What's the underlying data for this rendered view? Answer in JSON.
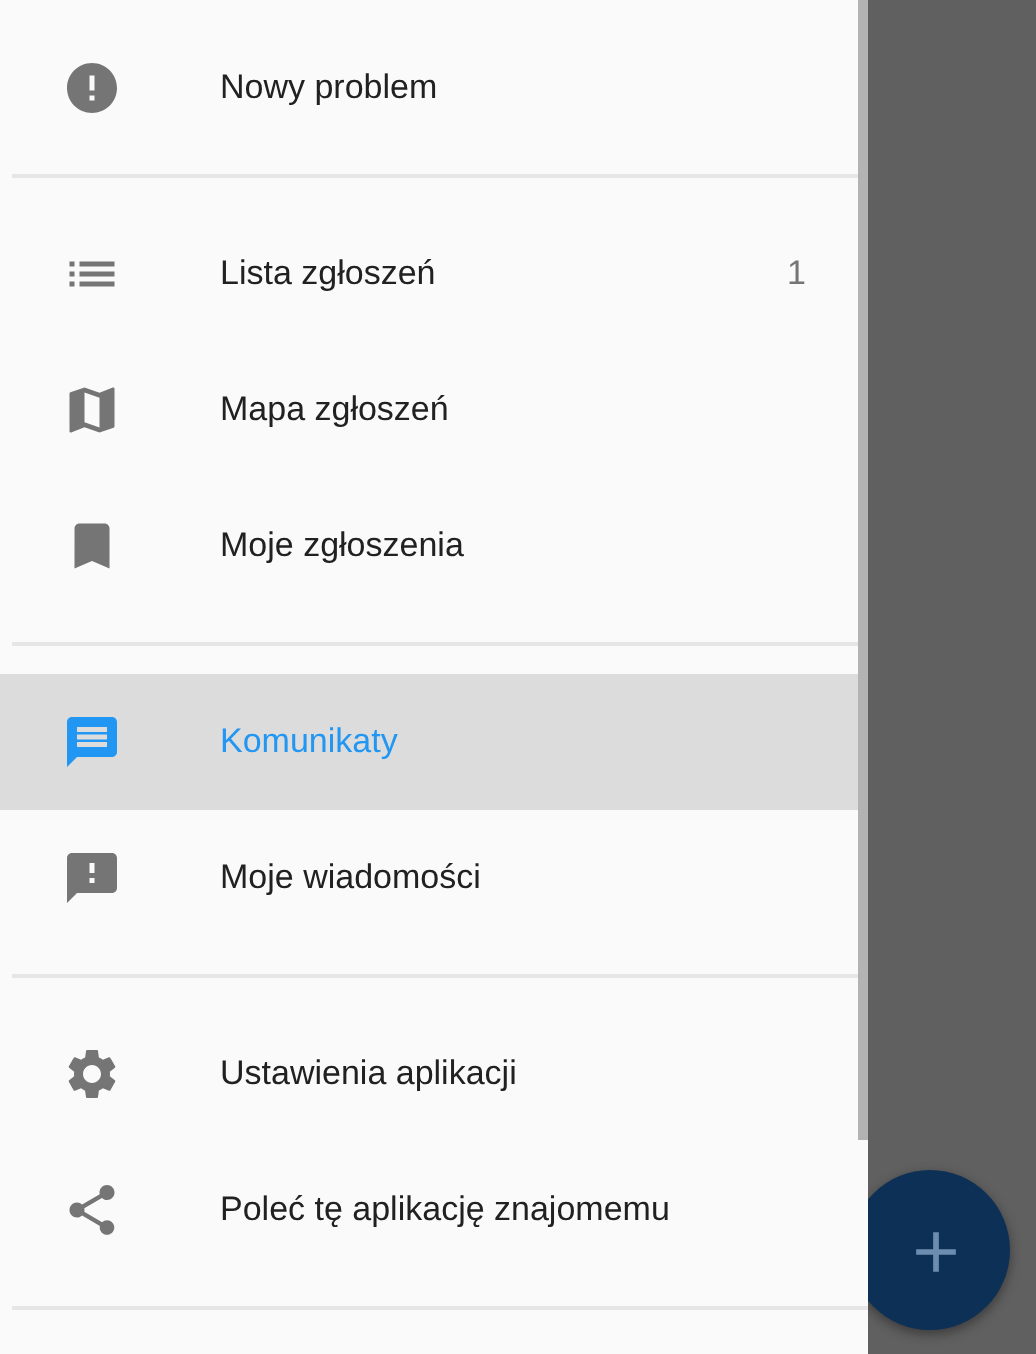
{
  "drawer": {
    "sections": [
      {
        "items": [
          {
            "kind": "alert",
            "label": "Nowy problem",
            "selected": false
          }
        ]
      },
      {
        "items": [
          {
            "kind": "list",
            "label": "Lista zgłoszeń",
            "badge": "1",
            "selected": false
          },
          {
            "kind": "map",
            "label": "Mapa zgłoszeń",
            "selected": false
          },
          {
            "kind": "bookmark",
            "label": "Moje zgłoszenia",
            "selected": false
          }
        ]
      },
      {
        "items": [
          {
            "kind": "message",
            "label": "Komunikaty",
            "selected": true
          },
          {
            "kind": "feedback",
            "label": "Moje wiadomości",
            "selected": false
          }
        ]
      },
      {
        "items": [
          {
            "kind": "settings",
            "label": "Ustawienia aplikacji",
            "selected": false
          },
          {
            "kind": "share",
            "label": "Poleć tę aplikację znajomemu",
            "selected": false
          }
        ]
      }
    ]
  }
}
